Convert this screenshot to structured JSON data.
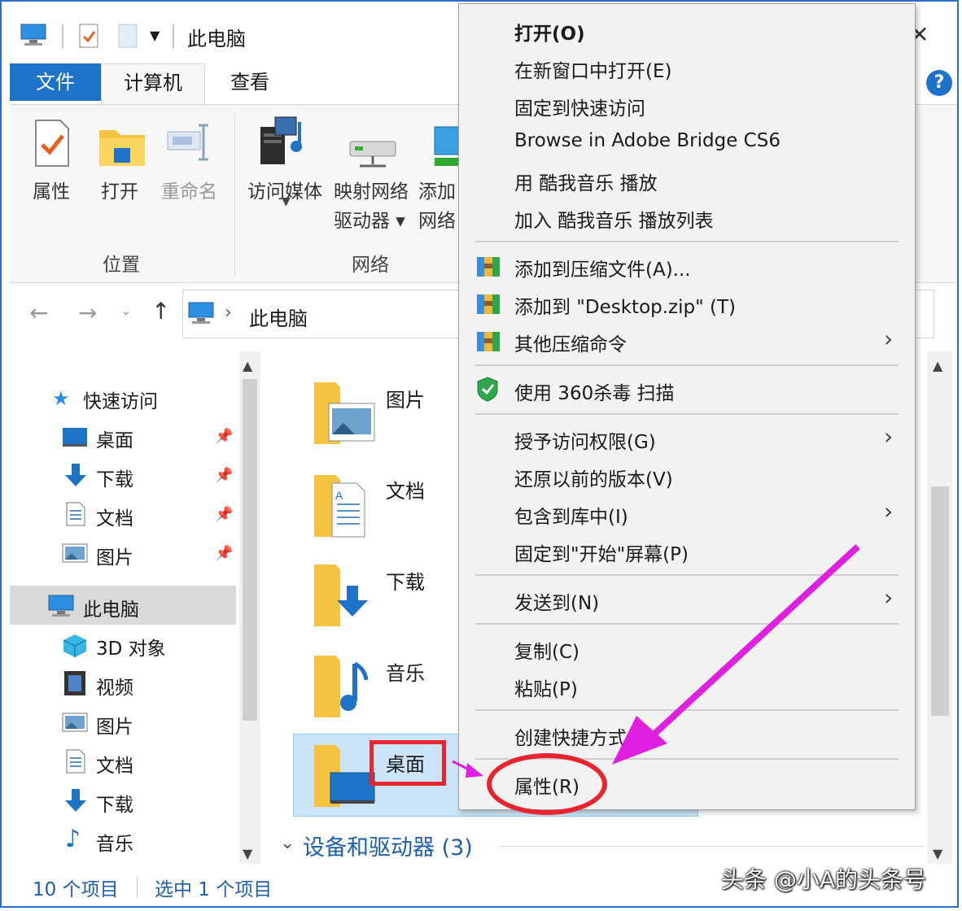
{
  "window": {
    "title": "此电脑"
  },
  "ribbon": {
    "tabs": [
      {
        "label": "文件"
      },
      {
        "label": "计算机"
      },
      {
        "label": "查看"
      }
    ],
    "help": "?",
    "buttons": [
      {
        "label": "属性",
        "icon": "checkmark-page-icon"
      },
      {
        "label": "打开",
        "icon": "folder-open-icon"
      },
      {
        "label": "重命名",
        "icon": "rename-icon"
      },
      {
        "label": "访问媒体",
        "icon": "media-server-icon"
      },
      {
        "label": "映射网络",
        "label2": "驱动器 ▾",
        "icon": "network-drive-icon"
      },
      {
        "label": "添加",
        "label2": "网络",
        "icon": "add-network-location-icon"
      }
    ],
    "groups": [
      {
        "label": "位置"
      },
      {
        "label": "网络"
      }
    ]
  },
  "address": {
    "path": "此电脑",
    "separator": "›"
  },
  "nav_pane": {
    "quick_access": "快速访问",
    "quick_items": [
      {
        "label": "桌面",
        "icon": "desktop-icon"
      },
      {
        "label": "下载",
        "icon": "download-icon"
      },
      {
        "label": "文档",
        "icon": "document-icon"
      },
      {
        "label": "图片",
        "icon": "picture-icon"
      }
    ],
    "this_pc": "此电脑",
    "pc_items": [
      {
        "label": "3D 对象",
        "icon": "cube-icon"
      },
      {
        "label": "视频",
        "icon": "video-icon"
      },
      {
        "label": "图片",
        "icon": "picture-icon"
      },
      {
        "label": "文档",
        "icon": "document-icon"
      },
      {
        "label": "下载",
        "icon": "download-icon"
      },
      {
        "label": "音乐",
        "icon": "music-icon"
      }
    ]
  },
  "content": {
    "folders": [
      {
        "label": "图片"
      },
      {
        "label": "文档"
      },
      {
        "label": "下载"
      },
      {
        "label": "音乐"
      },
      {
        "label": "桌面"
      }
    ],
    "devices_header": "设备和驱动器 (3)"
  },
  "status": {
    "items": "10 个项目",
    "selected": "选中 1 个项目"
  },
  "context_menu": {
    "items": [
      {
        "label": "打开(O)"
      },
      {
        "label": "在新窗口中打开(E)"
      },
      {
        "label": "固定到快速访问"
      },
      {
        "label": "Browse in Adobe Bridge CS6"
      },
      {
        "label": "用 酷我音乐 播放"
      },
      {
        "label": "加入 酷我音乐 播放列表"
      },
      {
        "label": "添加到压缩文件(A)..."
      },
      {
        "label": "添加到 \"Desktop.zip\" (T)"
      },
      {
        "label": "其他压缩命令"
      },
      {
        "label": "使用 360杀毒 扫描"
      },
      {
        "label": "授予访问权限(G)"
      },
      {
        "label": "还原以前的版本(V)"
      },
      {
        "label": "包含到库中(I)"
      },
      {
        "label": "固定到\"开始\"屏幕(P)"
      },
      {
        "label": "发送到(N)"
      },
      {
        "label": "复制(C)"
      },
      {
        "label": "粘贴(P)"
      },
      {
        "label": "创建快捷方式(S)"
      },
      {
        "label": "属性(R)"
      }
    ]
  },
  "annotation": {
    "highlight_color": "#e8252e",
    "arrow_color": "#e020e0"
  },
  "watermark": "头条 @小A的头条号"
}
